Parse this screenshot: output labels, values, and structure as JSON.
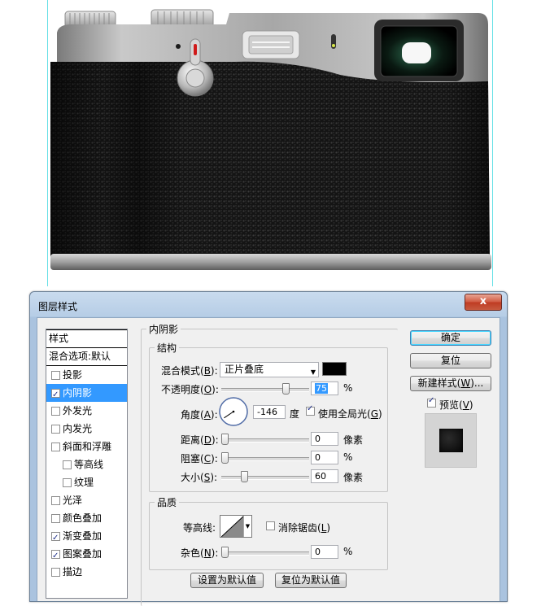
{
  "dialog": {
    "title": "图层样式",
    "close_label": "x"
  },
  "styles_panel": {
    "header": "样式",
    "blend_options": "混合选项:默认",
    "items": [
      {
        "label": "投影",
        "checked": false,
        "selected": false,
        "sub": false
      },
      {
        "label": "内阴影",
        "checked": true,
        "selected": true,
        "sub": false
      },
      {
        "label": "外发光",
        "checked": false,
        "selected": false,
        "sub": false
      },
      {
        "label": "内发光",
        "checked": false,
        "selected": false,
        "sub": false
      },
      {
        "label": "斜面和浮雕",
        "checked": false,
        "selected": false,
        "sub": false
      },
      {
        "label": "等高线",
        "checked": false,
        "selected": false,
        "sub": true
      },
      {
        "label": "纹理",
        "checked": false,
        "selected": false,
        "sub": true
      },
      {
        "label": "光泽",
        "checked": false,
        "selected": false,
        "sub": false
      },
      {
        "label": "颜色叠加",
        "checked": false,
        "selected": false,
        "sub": false
      },
      {
        "label": "渐变叠加",
        "checked": true,
        "selected": false,
        "sub": false
      },
      {
        "label": "图案叠加",
        "checked": true,
        "selected": false,
        "sub": false
      },
      {
        "label": "描边",
        "checked": false,
        "selected": false,
        "sub": false
      }
    ]
  },
  "inner_shadow": {
    "section_title": "内阴影",
    "structure": {
      "title": "结构",
      "blend_mode_label": "混合模式(",
      "blend_mode_key": "B",
      "blend_mode_value": "正片叠底",
      "shadow_color": "#000000",
      "opacity_label": "不透明度(",
      "opacity_key": "O",
      "opacity_value": "75",
      "opacity_unit": "%",
      "angle_label": "角度(",
      "angle_key": "A",
      "angle_value": "-146",
      "angle_unit": "度",
      "global_light_label": "使用全局光(",
      "global_light_key": "G",
      "global_light_checked": true,
      "distance_label": "距离(",
      "distance_key": "D",
      "distance_value": "0",
      "distance_unit": "像素",
      "choke_label": "阻塞(",
      "choke_key": "C",
      "choke_value": "0",
      "choke_unit": "%",
      "size_label": "大小(",
      "size_key": "S",
      "size_value": "60",
      "size_unit": "像素"
    },
    "quality": {
      "title": "品质",
      "contour_label": "等高线:",
      "antialias_label": "消除锯齿(",
      "antialias_key": "L",
      "antialias_checked": false,
      "noise_label": "杂色(",
      "noise_key": "N",
      "noise_value": "0",
      "noise_unit": "%"
    },
    "make_default_label": "设置为默认值",
    "reset_default_label": "复位为默认值"
  },
  "buttons": {
    "ok_label": "确定",
    "reset_label": "复位",
    "new_style_label": "新建样式(",
    "new_style_key": "W",
    "new_style_suffix": ")...",
    "preview_label": "预览(",
    "preview_key": "V",
    "preview_checked": true
  },
  "levels": {
    "opacity": 75,
    "angle_degrees": -146,
    "distance": 0,
    "choke": 0,
    "size": 60,
    "noise": 0
  }
}
